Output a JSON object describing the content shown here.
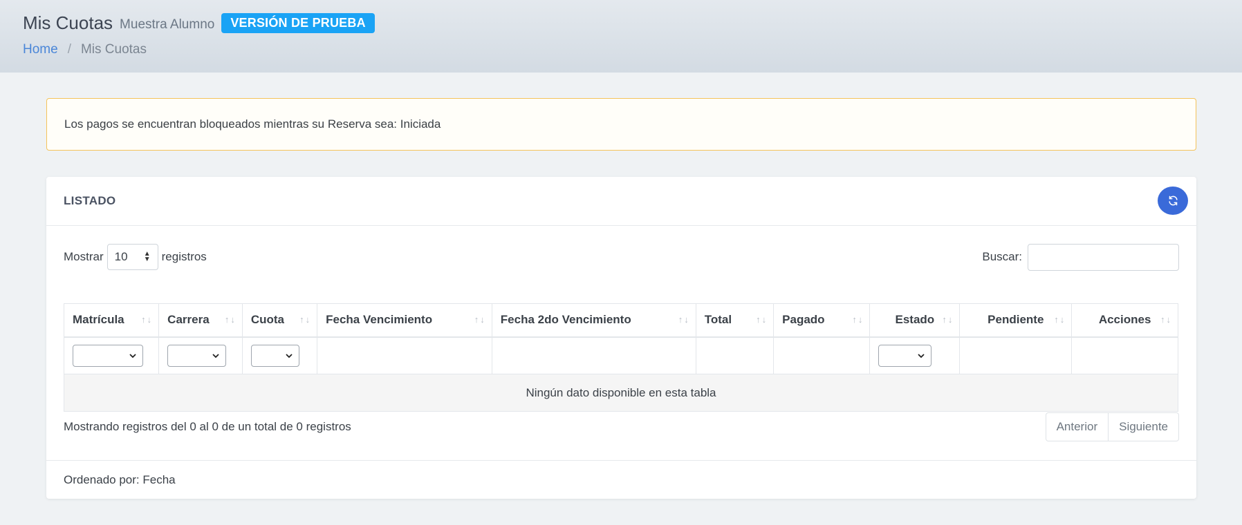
{
  "header": {
    "title": "Mis Cuotas",
    "subtitle": "Muestra Alumno",
    "badge": "VERSIÓN DE PRUEBA",
    "breadcrumb": {
      "home": "Home",
      "separator": "/",
      "current": "Mis Cuotas"
    }
  },
  "alert": {
    "text": "Los pagos se encuentran bloqueados mientras su Reserva sea: Iniciada"
  },
  "card": {
    "title": "LISTADO",
    "refresh_icon": "refresh-icon",
    "length": {
      "prefix": "Mostrar",
      "value": "10",
      "suffix": "registros"
    },
    "search": {
      "label": "Buscar:",
      "value": "",
      "placeholder": ""
    },
    "columns": [
      "Matrícula",
      "Carrera",
      "Cuota",
      "Fecha Vencimiento",
      "Fecha 2do Vencimiento",
      "Total",
      "Pagado",
      "Estado",
      "Pendiente",
      "Acciones"
    ],
    "empty_message": "Ningún dato disponible en esta tabla",
    "info": "Mostrando registros del 0 al 0 de un total de 0 registros",
    "pager": {
      "previous": "Anterior",
      "next": "Siguiente"
    },
    "footer": "Ordenado por: Fecha"
  },
  "colors": {
    "accent": "#3a6ad9",
    "badge": "#1aa3f5",
    "alert_border": "#f4c35a",
    "link": "#4a86d8"
  }
}
